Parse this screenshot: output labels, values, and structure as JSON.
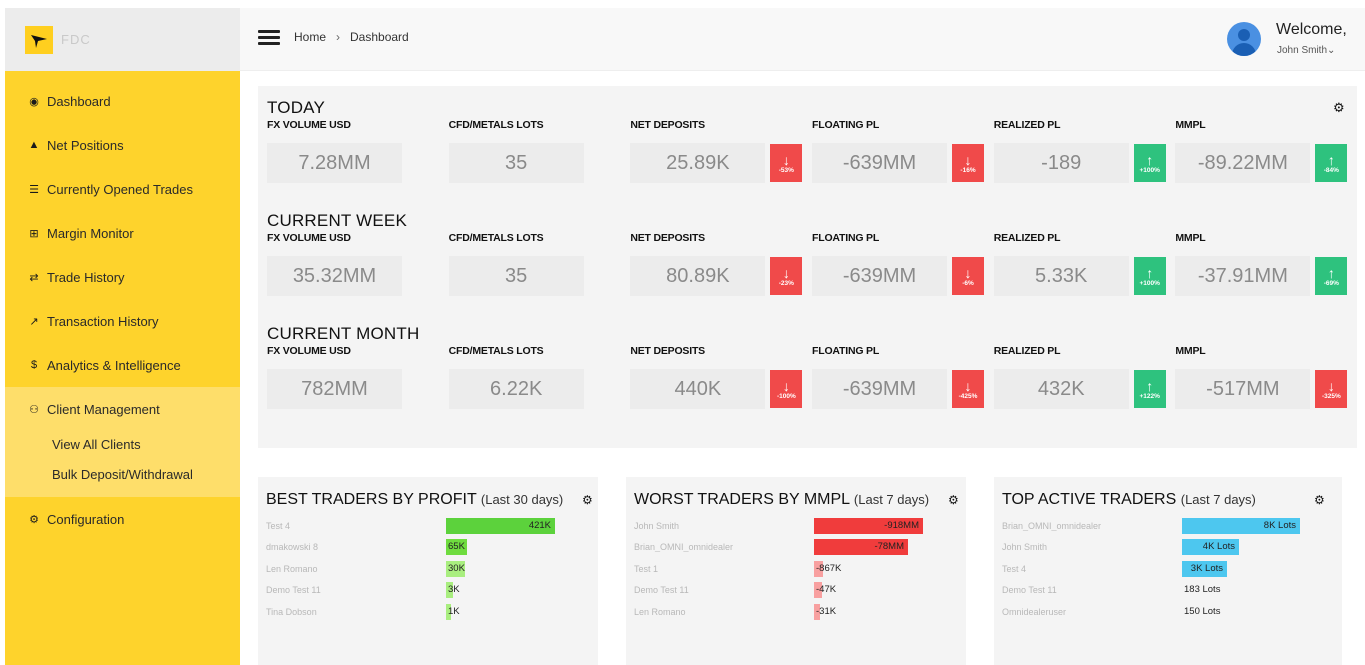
{
  "sidebar": {
    "brand_text": "FDC",
    "items": [
      {
        "icon": "tachometer-icon",
        "glyph": "◉",
        "label": "Dashboard"
      },
      {
        "icon": "area-chart-icon",
        "glyph": "▲",
        "label": "Net Positions"
      },
      {
        "icon": "list-icon",
        "glyph": "☰",
        "label": "Currently Opened Trades"
      },
      {
        "icon": "plus-square-icon",
        "glyph": "⊞",
        "label": "Margin Monitor"
      },
      {
        "icon": "exchange-icon",
        "glyph": "⇄",
        "label": "Trade History"
      },
      {
        "icon": "line-chart-icon",
        "glyph": "↗",
        "label": "Transaction History"
      },
      {
        "icon": "dollar-icon",
        "glyph": "$",
        "label": "Analytics & Intelligence"
      },
      {
        "icon": "users-icon",
        "glyph": "⚇",
        "label": "Client Management"
      },
      {
        "icon": "cogs-icon",
        "glyph": "⚙",
        "label": "Configuration"
      }
    ],
    "sub_items": [
      "View All Clients",
      "Bulk Deposit/Withdrawal"
    ]
  },
  "header": {
    "breadcrumb": [
      "Home",
      "Dashboard"
    ],
    "breadcrumb_sep": "›",
    "welcome": "Welcome,",
    "user": "John Smith⌄"
  },
  "stats": {
    "gear_icon": "⚙",
    "labels": [
      "FX VOLUME USD",
      "CFD/METALS LOTS",
      "NET DEPOSITS",
      "FLOATING PL",
      "REALIZED PL",
      "MMPL"
    ],
    "sections": [
      {
        "title": "TODAY",
        "values": [
          "7.28MM",
          "35",
          "25.89K",
          "-639MM",
          "-189",
          "-89.22MM"
        ],
        "badges": [
          null,
          null,
          {
            "dir": "down",
            "text": "-53%"
          },
          {
            "dir": "down",
            "text": "-16%"
          },
          {
            "dir": "up",
            "text": "+100%"
          },
          {
            "dir": "up",
            "text": "-84%"
          }
        ]
      },
      {
        "title": "CURRENT WEEK",
        "values": [
          "35.32MM",
          "35",
          "80.89K",
          "-639MM",
          "5.33K",
          "-37.91MM"
        ],
        "badges": [
          null,
          null,
          {
            "dir": "down",
            "text": "-23%"
          },
          {
            "dir": "down",
            "text": "-6%"
          },
          {
            "dir": "up",
            "text": "+100%"
          },
          {
            "dir": "up",
            "text": "-69%"
          }
        ]
      },
      {
        "title": "CURRENT MONTH",
        "values": [
          "782MM",
          "6.22K",
          "440K",
          "-639MM",
          "432K",
          "-517MM"
        ],
        "badges": [
          null,
          null,
          {
            "dir": "down",
            "text": "-100%"
          },
          {
            "dir": "down",
            "text": "-425%"
          },
          {
            "dir": "up",
            "text": "+122%"
          },
          {
            "dir": "down",
            "text": "-325%"
          }
        ]
      }
    ]
  },
  "colors": {
    "down": "#f04a4a",
    "up": "#2ec27e",
    "green_bar": "#5cd23c",
    "red_bar": "#f03c3c",
    "blue_bar": "#4dc7ef"
  },
  "panels": [
    {
      "title": "BEST TRADERS BY PROFIT",
      "subtitle": "(Last 30 days)",
      "color": "green",
      "rows": [
        {
          "name": "Test 4",
          "value": "421K",
          "frac": 0.92
        },
        {
          "name": "dmakowski 8",
          "value": "65K",
          "frac": 0.18
        },
        {
          "name": "Len Romano",
          "value": "30K",
          "frac": 0.16
        },
        {
          "name": "Demo Test 11",
          "value": "3K",
          "frac": 0.06
        },
        {
          "name": "Tina Dobson",
          "value": "1K",
          "frac": 0.04
        }
      ]
    },
    {
      "title": "WORST TRADERS BY MMPL",
      "subtitle": "(Last 7 days)",
      "color": "red",
      "rows": [
        {
          "name": "John Smith",
          "value": "-918MM",
          "frac": 0.92
        },
        {
          "name": "Brian_OMNI_omnidealer",
          "value": "-78MM",
          "frac": 0.8
        },
        {
          "name": "Test 1",
          "value": "-867K",
          "frac": 0.08
        },
        {
          "name": "Demo Test 11",
          "value": "-47K",
          "frac": 0.07
        },
        {
          "name": "Len Romano",
          "value": "-31K",
          "frac": 0.05
        }
      ]
    },
    {
      "title": "TOP ACTIVE TRADERS",
      "subtitle": "(Last 7 days)",
      "color": "blue",
      "rows": [
        {
          "name": "Brian_OMNI_omnidealer",
          "value": "8K Lots",
          "frac": 1.0
        },
        {
          "name": "John Smith",
          "value": "4K Lots",
          "frac": 0.48
        },
        {
          "name": "Test 4",
          "value": "3K Lots",
          "frac": 0.38
        },
        {
          "name": "Demo Test 11",
          "value": "183 Lots",
          "frac": 0.0
        },
        {
          "name": "Omnidealeruser",
          "value": "150 Lots",
          "frac": 0.0
        }
      ]
    }
  ]
}
